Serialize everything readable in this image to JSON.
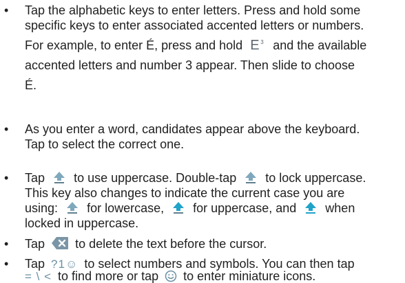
{
  "bullets": {
    "b1": {
      "l1": "Tap the alphabetic keys to enter letters. Press and hold some",
      "l2": "specific keys to enter associated accented letters or numbers.",
      "l3a": "For example, to enter É, press and hold",
      "key_e": "E",
      "key_e_sup": "3",
      "l3b": "and the available",
      "l4": "accented letters and number 3 appear. Then slide to choose",
      "l5": "É."
    },
    "b2": {
      "l1": "As you enter a word, candidates appear above the keyboard.",
      "l2": "Tap to select the correct one."
    },
    "b3": {
      "l1a": "Tap",
      "l1b": "to use uppercase. Double-tap",
      "l1c": "to lock uppercase.",
      "l2": "This key also changes to indicate the current case you are",
      "l3a": "using:",
      "l3b": "for lowercase,",
      "l3c": "for uppercase, and",
      "l3d": "when",
      "l4": "locked in uppercase."
    },
    "b4": {
      "l1a": "Tap",
      "l1b": "to delete the text before the cursor."
    },
    "b5": {
      "l1a": "Tap",
      "sym_key": "?1☺",
      "l1b": "to select numbers and symbols. You can then tap",
      "sym_key2": "= \\ <",
      "l2a": "to find more or tap",
      "l2b": "to enter miniature icons."
    }
  },
  "bullet_char": "•",
  "icons": {
    "shift": "shift-arrow-icon",
    "delete": "backspace-icon",
    "emoji": "smiley-icon"
  },
  "colors": {
    "icon_fill": "#7fa8bc",
    "icon_base": "#5f7f8f"
  }
}
